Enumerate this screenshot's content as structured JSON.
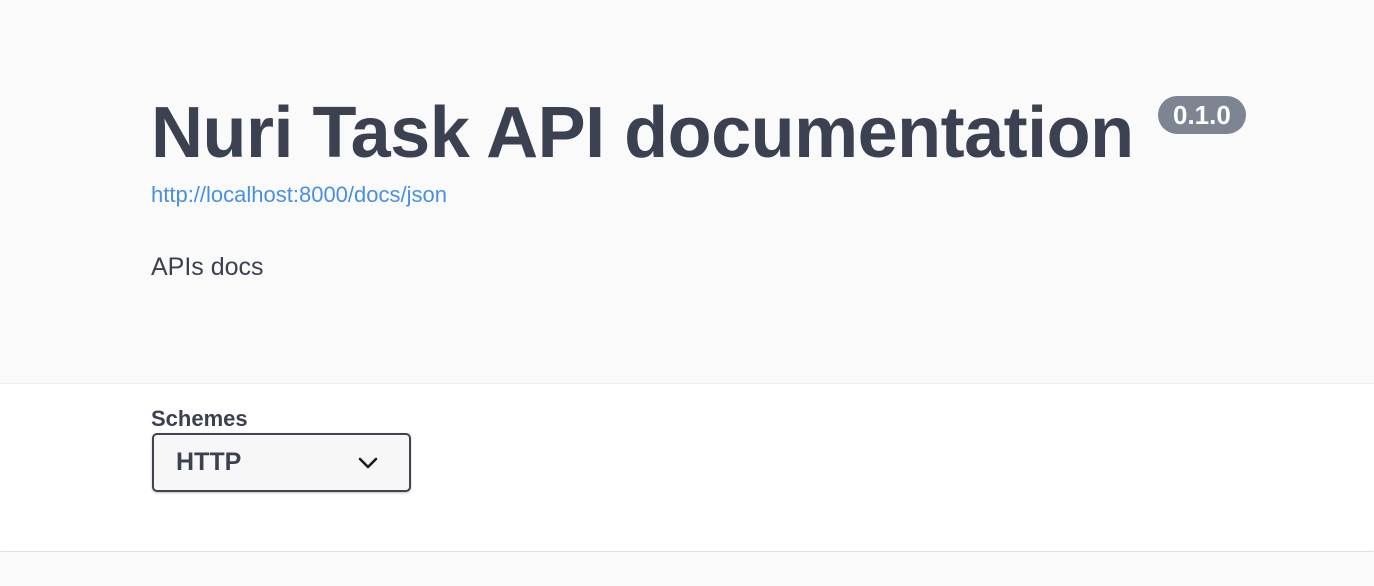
{
  "info": {
    "title": "Nuri Task API documentation",
    "version": "0.1.0",
    "spec_url": "http://localhost:8000/docs/json",
    "description": "APIs docs"
  },
  "schemes": {
    "label": "Schemes",
    "selected": "HTTP",
    "icon": "chevron-down-icon"
  },
  "colors": {
    "text": "#3b4151",
    "link": "#4990e2",
    "badge": "#7d8492"
  }
}
